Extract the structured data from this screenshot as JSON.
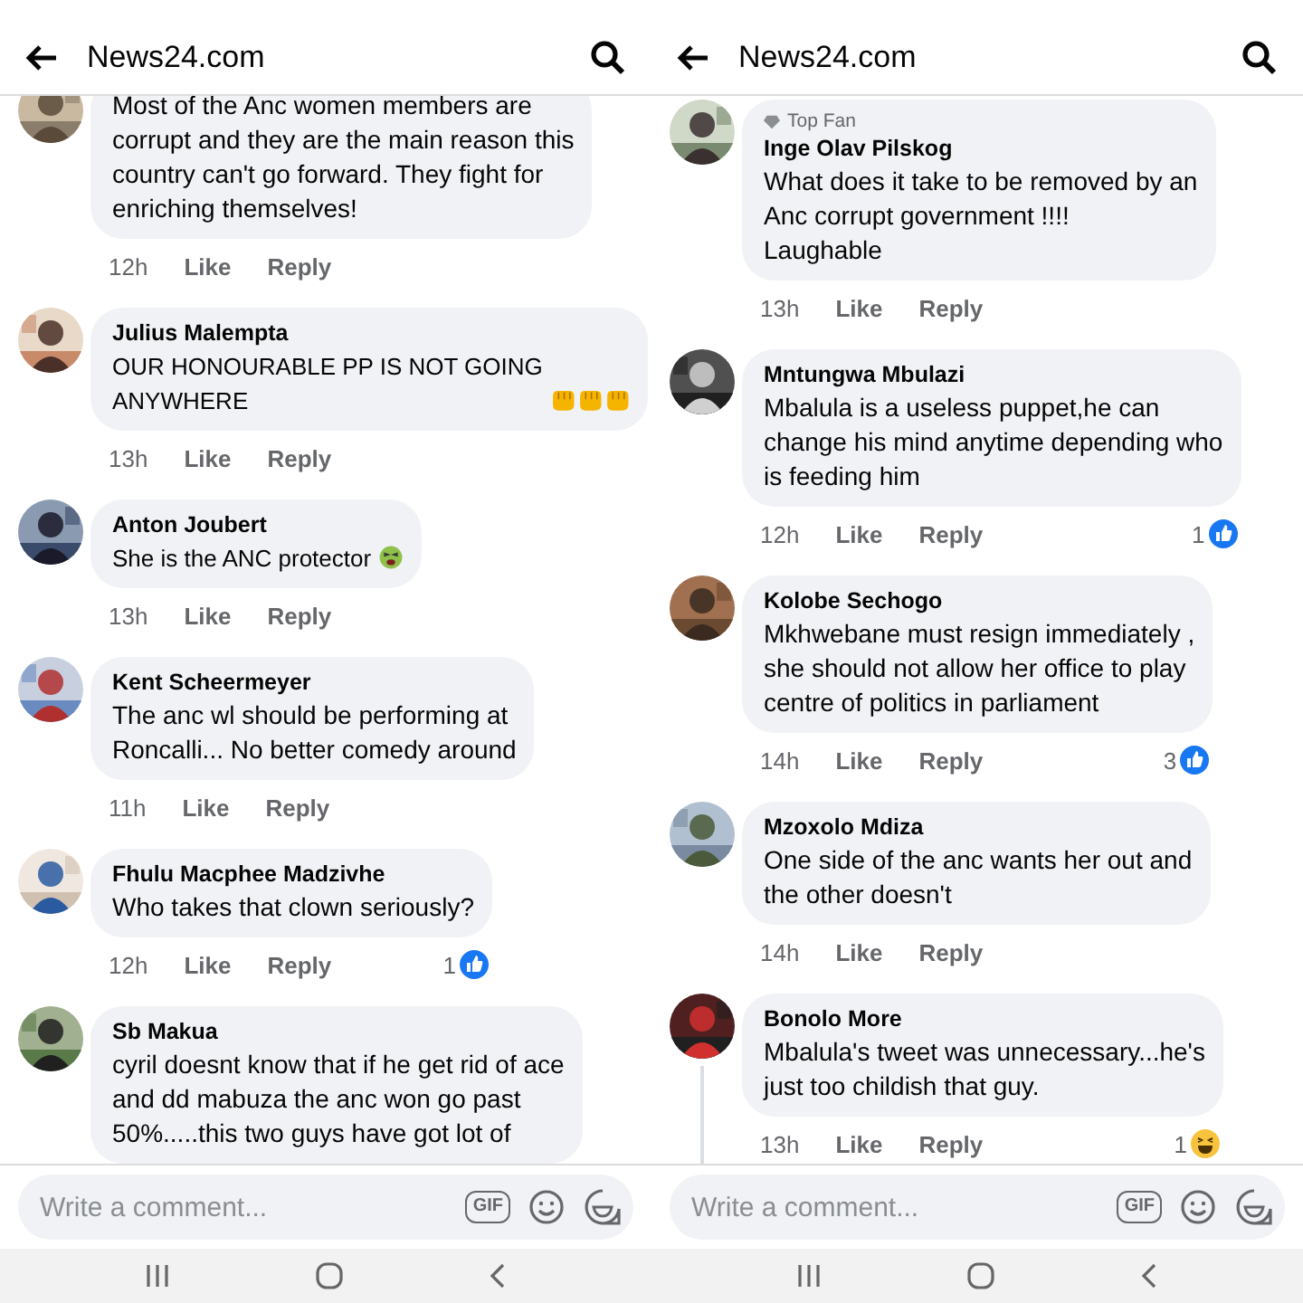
{
  "screens": [
    {
      "header": {
        "title": "News24.com"
      },
      "comments": [
        {
          "text": "Most of the Anc women members are\ncorrupt and they are the main reason this\ncountry can't go forward. They fight for\nenriching themselves!",
          "time": "12h",
          "like": "Like",
          "reply": "Reply"
        },
        {
          "name": "Julius Malempta",
          "text": "OUR HONOURABLE PP IS NOT GOING\nANYWHERE",
          "emoji": [
            {
              "kind": "fist"
            },
            {
              "kind": "fist"
            },
            {
              "kind": "fist"
            }
          ],
          "time": "13h",
          "like": "Like",
          "reply": "Reply"
        },
        {
          "name": "Anton Joubert",
          "text": "She is the ANC protector",
          "emoji": [
            {
              "kind": "tired-face"
            }
          ],
          "time": "13h",
          "like": "Like",
          "reply": "Reply"
        },
        {
          "name": "Kent Scheermeyer",
          "text": "The anc wl should be performing at\nRoncalli... No better comedy around",
          "time": "11h",
          "like": "Like",
          "reply": "Reply"
        },
        {
          "name": "Fhulu Macphee Madzivhe",
          "text": "Who takes that clown seriously?",
          "time": "12h",
          "like": "Like",
          "reply": "Reply",
          "reaction": {
            "count": "1",
            "kind": "like"
          }
        },
        {
          "name": "Sb Makua",
          "text": "cyril doesnt know that if he get rid of ace\nand dd mabuza the anc won go past\n50%.....this two guys have got lot of"
        }
      ],
      "composer": {
        "placeholder": "Write a comment...",
        "gif_label": "GIF"
      }
    },
    {
      "header": {
        "title": "News24.com"
      },
      "comments": [
        {
          "badge": "Top Fan",
          "name": "Inge Olav Pilskog",
          "text": "What does it take to be removed by an\nAnc corrupt government !!!!\nLaughable",
          "time": "13h",
          "like": "Like",
          "reply": "Reply"
        },
        {
          "name": "Mntungwa Mbulazi",
          "text": "Mbalula is a useless puppet,he can\nchange his mind anytime depending who\nis feeding him",
          "time": "12h",
          "like": "Like",
          "reply": "Reply",
          "reaction": {
            "count": "1",
            "kind": "like"
          }
        },
        {
          "name": "Kolobe Sechogo",
          "text": "Mkhwebane must resign immediately ,\nshe should not allow her office to play\ncentre of politics in parliament",
          "time": "14h",
          "like": "Like",
          "reply": "Reply",
          "reaction": {
            "count": "3",
            "kind": "like"
          }
        },
        {
          "name": "Mzoxolo Mdiza",
          "text": "One side of the anc wants her out and\nthe other doesn't",
          "time": "14h",
          "like": "Like",
          "reply": "Reply"
        },
        {
          "name": "Bonolo More",
          "text": "Mbalula's tweet was unnecessary...he's\njust too childish that guy.",
          "time": "13h",
          "like": "Like",
          "reply": "Reply",
          "reaction": {
            "count": "1",
            "kind": "haha"
          },
          "has_replies": true
        }
      ],
      "composer": {
        "placeholder": "Write a comment...",
        "gif_label": "GIF"
      }
    }
  ]
}
